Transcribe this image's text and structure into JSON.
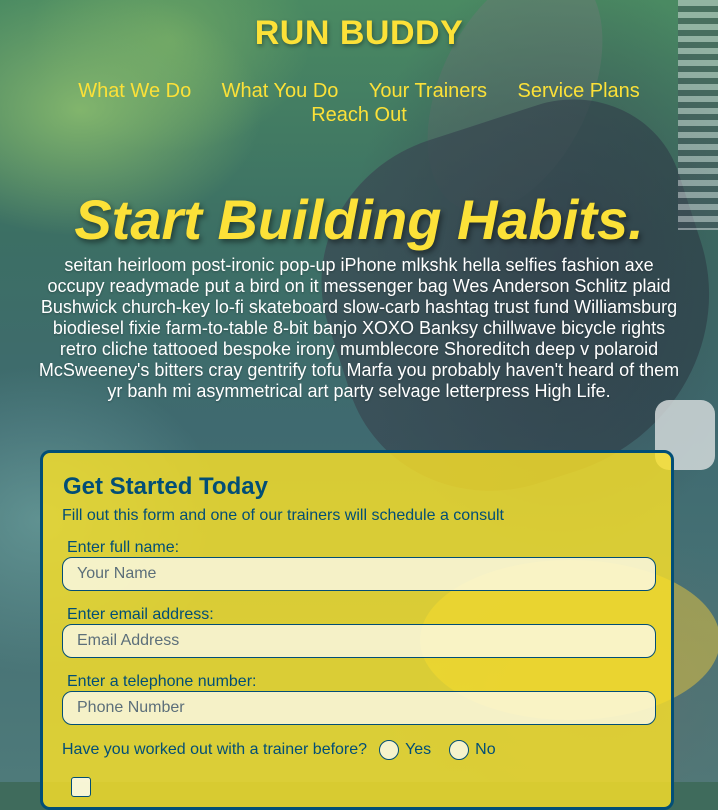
{
  "brand": "RUN BUDDY",
  "nav": [
    "What We Do",
    "What You Do",
    "Your Trainers",
    "Service Plans",
    "Reach Out"
  ],
  "hero": {
    "title": "Start Building Habits.",
    "body": "seitan heirloom post-ironic pop-up iPhone mlkshk hella selfies fashion axe occupy readymade put a bird on it messenger bag Wes Anderson Schlitz plaid Bushwick church-key lo-fi skateboard slow-carb hashtag trust fund Williamsburg biodiesel fixie farm-to-table 8-bit banjo XOXO Banksy chillwave bicycle rights retro cliche tattooed bespoke irony mumblecore Shoreditch deep v polaroid McSweeney's bitters cray gentrify tofu Marfa you probably haven't heard of them yr banh mi asymmetrical art party selvage letterpress High Life."
  },
  "form": {
    "title": "Get Started Today",
    "subtitle": "Fill out this form and one of our trainers will schedule a consult",
    "fields": [
      {
        "label": "Enter full name:",
        "placeholder": "Your Name"
      },
      {
        "label": "Enter email address:",
        "placeholder": "Email Address"
      },
      {
        "label": "Enter a telephone number:",
        "placeholder": "Phone Number"
      }
    ],
    "trainer_question": "Have you worked out with a trainer before?",
    "options": [
      "Yes",
      "No"
    ]
  },
  "colors": {
    "accent": "#fce138",
    "dark": "#024e76"
  }
}
